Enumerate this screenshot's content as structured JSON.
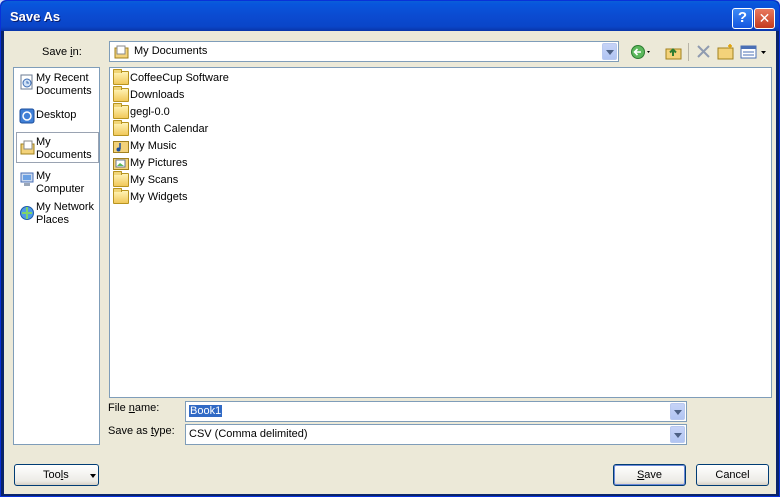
{
  "window": {
    "title": "Save As",
    "help_glyph": "?",
    "close_glyph": "✕"
  },
  "save_in": {
    "label_pre": "Save ",
    "label_u": "i",
    "label_post": "n:",
    "value": "My Documents"
  },
  "places": [
    {
      "label": "My Recent Documents",
      "icon": "recent-documents-icon"
    },
    {
      "label": "Desktop",
      "icon": "desktop-icon"
    },
    {
      "label": "My Documents",
      "icon": "my-documents-icon"
    },
    {
      "label": "My Computer",
      "icon": "my-computer-icon"
    },
    {
      "label": "My Network Places",
      "icon": "network-places-icon"
    }
  ],
  "files": [
    {
      "name": "CoffeeCup Software",
      "icon": "folder-icon"
    },
    {
      "name": "Downloads",
      "icon": "folder-icon"
    },
    {
      "name": "gegl-0.0",
      "icon": "folder-icon"
    },
    {
      "name": "Month Calendar",
      "icon": "folder-icon"
    },
    {
      "name": "My Music",
      "icon": "music-folder-icon"
    },
    {
      "name": "My Pictures",
      "icon": "pictures-folder-icon"
    },
    {
      "name": "My Scans",
      "icon": "folder-icon"
    },
    {
      "name": "My Widgets",
      "icon": "folder-icon"
    }
  ],
  "file_name": {
    "label_pre": "File ",
    "label_u": "n",
    "label_post": "ame:",
    "value": "Book1"
  },
  "save_as_type": {
    "label_pre": "Save as ",
    "label_u": "t",
    "label_post": "ype:",
    "value": "CSV (Comma delimited)"
  },
  "buttons": {
    "tools_pre": "Too",
    "tools_u": "l",
    "tools_post": "s",
    "save_u": "S",
    "save_post": "ave",
    "cancel": "Cancel"
  },
  "colors": {
    "titlebar": "#0a4bd1",
    "dialog_bg": "#ece9d8",
    "selection": "#316ac5"
  }
}
